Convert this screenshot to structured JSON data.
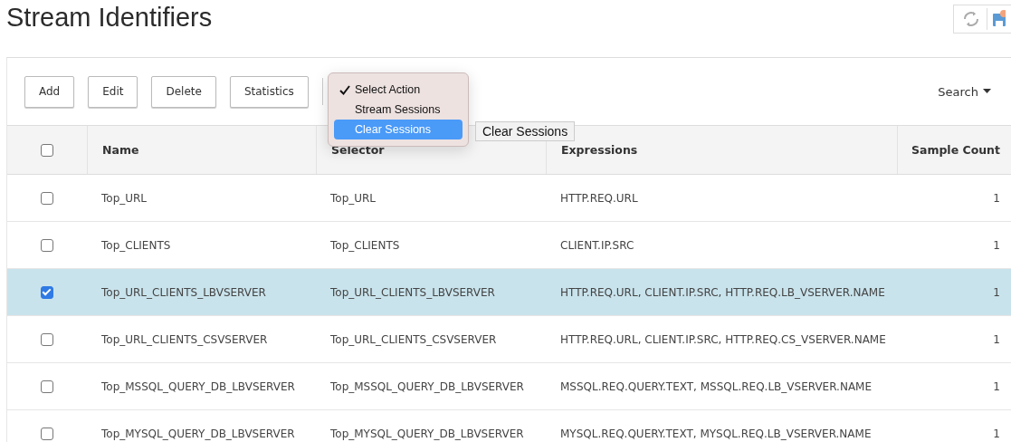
{
  "page": {
    "title": "Stream Identifiers"
  },
  "toolbar": {
    "buttons": [
      "Add",
      "Edit",
      "Delete",
      "Statistics"
    ],
    "search": "Search"
  },
  "action_menu": {
    "items": [
      {
        "label": "Select Action",
        "selected": true,
        "highlighted": false
      },
      {
        "label": "Stream Sessions",
        "selected": false,
        "highlighted": false
      },
      {
        "label": "Clear Sessions",
        "selected": false,
        "highlighted": true
      }
    ],
    "tooltip": "Clear Sessions"
  },
  "table": {
    "select_all": false,
    "columns": [
      "Name",
      "Selector",
      "Expressions",
      "Sample Count"
    ],
    "rows": [
      {
        "selected": false,
        "cells": [
          "Top_URL",
          "Top_URL",
          "HTTP.REQ.URL",
          "1"
        ]
      },
      {
        "selected": false,
        "cells": [
          "Top_CLIENTS",
          "Top_CLIENTS",
          "CLIENT.IP.SRC",
          "1"
        ]
      },
      {
        "selected": true,
        "cells": [
          "Top_URL_CLIENTS_LBVSERVER",
          "Top_URL_CLIENTS_LBVSERVER",
          "HTTP.REQ.URL, CLIENT.IP.SRC, HTTP.REQ.LB_VSERVER.NAME",
          "1"
        ]
      },
      {
        "selected": false,
        "cells": [
          "Top_URL_CLIENTS_CSVSERVER",
          "Top_URL_CLIENTS_CSVSERVER",
          "HTTP.REQ.URL, CLIENT.IP.SRC, HTTP.REQ.CS_VSERVER.NAME",
          "1"
        ]
      },
      {
        "selected": false,
        "cells": [
          "Top_MSSQL_QUERY_DB_LBVSERVER",
          "Top_MSSQL_QUERY_DB_LBVSERVER",
          "MSSQL.REQ.QUERY.TEXT, MSSQL.REQ.LB_VSERVER.NAME",
          "1"
        ]
      },
      {
        "selected": false,
        "cells": [
          "Top_MYSQL_QUERY_DB_LBVSERVER",
          "Top_MYSQL_QUERY_DB_LBVSERVER",
          "MYSQL.REQ.QUERY.TEXT, MYSQL.REQ.LB_VSERVER.NAME",
          "1"
        ]
      }
    ]
  }
}
